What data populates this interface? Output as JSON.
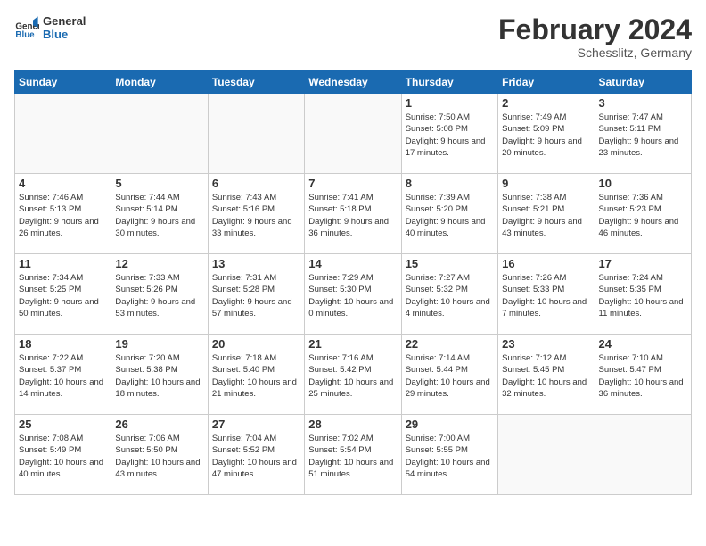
{
  "header": {
    "logo_line1": "General",
    "logo_line2": "Blue",
    "month_title": "February 2024",
    "location": "Schesslitz, Germany"
  },
  "weekdays": [
    "Sunday",
    "Monday",
    "Tuesday",
    "Wednesday",
    "Thursday",
    "Friday",
    "Saturday"
  ],
  "weeks": [
    [
      {
        "day": "",
        "empty": true
      },
      {
        "day": "",
        "empty": true
      },
      {
        "day": "",
        "empty": true
      },
      {
        "day": "",
        "empty": true
      },
      {
        "day": "1",
        "sunrise": "7:50 AM",
        "sunset": "5:08 PM",
        "daylight": "9 hours and 17 minutes."
      },
      {
        "day": "2",
        "sunrise": "7:49 AM",
        "sunset": "5:09 PM",
        "daylight": "9 hours and 20 minutes."
      },
      {
        "day": "3",
        "sunrise": "7:47 AM",
        "sunset": "5:11 PM",
        "daylight": "9 hours and 23 minutes."
      }
    ],
    [
      {
        "day": "4",
        "sunrise": "7:46 AM",
        "sunset": "5:13 PM",
        "daylight": "9 hours and 26 minutes."
      },
      {
        "day": "5",
        "sunrise": "7:44 AM",
        "sunset": "5:14 PM",
        "daylight": "9 hours and 30 minutes."
      },
      {
        "day": "6",
        "sunrise": "7:43 AM",
        "sunset": "5:16 PM",
        "daylight": "9 hours and 33 minutes."
      },
      {
        "day": "7",
        "sunrise": "7:41 AM",
        "sunset": "5:18 PM",
        "daylight": "9 hours and 36 minutes."
      },
      {
        "day": "8",
        "sunrise": "7:39 AM",
        "sunset": "5:20 PM",
        "daylight": "9 hours and 40 minutes."
      },
      {
        "day": "9",
        "sunrise": "7:38 AM",
        "sunset": "5:21 PM",
        "daylight": "9 hours and 43 minutes."
      },
      {
        "day": "10",
        "sunrise": "7:36 AM",
        "sunset": "5:23 PM",
        "daylight": "9 hours and 46 minutes."
      }
    ],
    [
      {
        "day": "11",
        "sunrise": "7:34 AM",
        "sunset": "5:25 PM",
        "daylight": "9 hours and 50 minutes."
      },
      {
        "day": "12",
        "sunrise": "7:33 AM",
        "sunset": "5:26 PM",
        "daylight": "9 hours and 53 minutes."
      },
      {
        "day": "13",
        "sunrise": "7:31 AM",
        "sunset": "5:28 PM",
        "daylight": "9 hours and 57 minutes."
      },
      {
        "day": "14",
        "sunrise": "7:29 AM",
        "sunset": "5:30 PM",
        "daylight": "10 hours and 0 minutes."
      },
      {
        "day": "15",
        "sunrise": "7:27 AM",
        "sunset": "5:32 PM",
        "daylight": "10 hours and 4 minutes."
      },
      {
        "day": "16",
        "sunrise": "7:26 AM",
        "sunset": "5:33 PM",
        "daylight": "10 hours and 7 minutes."
      },
      {
        "day": "17",
        "sunrise": "7:24 AM",
        "sunset": "5:35 PM",
        "daylight": "10 hours and 11 minutes."
      }
    ],
    [
      {
        "day": "18",
        "sunrise": "7:22 AM",
        "sunset": "5:37 PM",
        "daylight": "10 hours and 14 minutes."
      },
      {
        "day": "19",
        "sunrise": "7:20 AM",
        "sunset": "5:38 PM",
        "daylight": "10 hours and 18 minutes."
      },
      {
        "day": "20",
        "sunrise": "7:18 AM",
        "sunset": "5:40 PM",
        "daylight": "10 hours and 21 minutes."
      },
      {
        "day": "21",
        "sunrise": "7:16 AM",
        "sunset": "5:42 PM",
        "daylight": "10 hours and 25 minutes."
      },
      {
        "day": "22",
        "sunrise": "7:14 AM",
        "sunset": "5:44 PM",
        "daylight": "10 hours and 29 minutes."
      },
      {
        "day": "23",
        "sunrise": "7:12 AM",
        "sunset": "5:45 PM",
        "daylight": "10 hours and 32 minutes."
      },
      {
        "day": "24",
        "sunrise": "7:10 AM",
        "sunset": "5:47 PM",
        "daylight": "10 hours and 36 minutes."
      }
    ],
    [
      {
        "day": "25",
        "sunrise": "7:08 AM",
        "sunset": "5:49 PM",
        "daylight": "10 hours and 40 minutes."
      },
      {
        "day": "26",
        "sunrise": "7:06 AM",
        "sunset": "5:50 PM",
        "daylight": "10 hours and 43 minutes."
      },
      {
        "day": "27",
        "sunrise": "7:04 AM",
        "sunset": "5:52 PM",
        "daylight": "10 hours and 47 minutes."
      },
      {
        "day": "28",
        "sunrise": "7:02 AM",
        "sunset": "5:54 PM",
        "daylight": "10 hours and 51 minutes."
      },
      {
        "day": "29",
        "sunrise": "7:00 AM",
        "sunset": "5:55 PM",
        "daylight": "10 hours and 54 minutes."
      },
      {
        "day": "",
        "empty": true
      },
      {
        "day": "",
        "empty": true
      }
    ]
  ]
}
